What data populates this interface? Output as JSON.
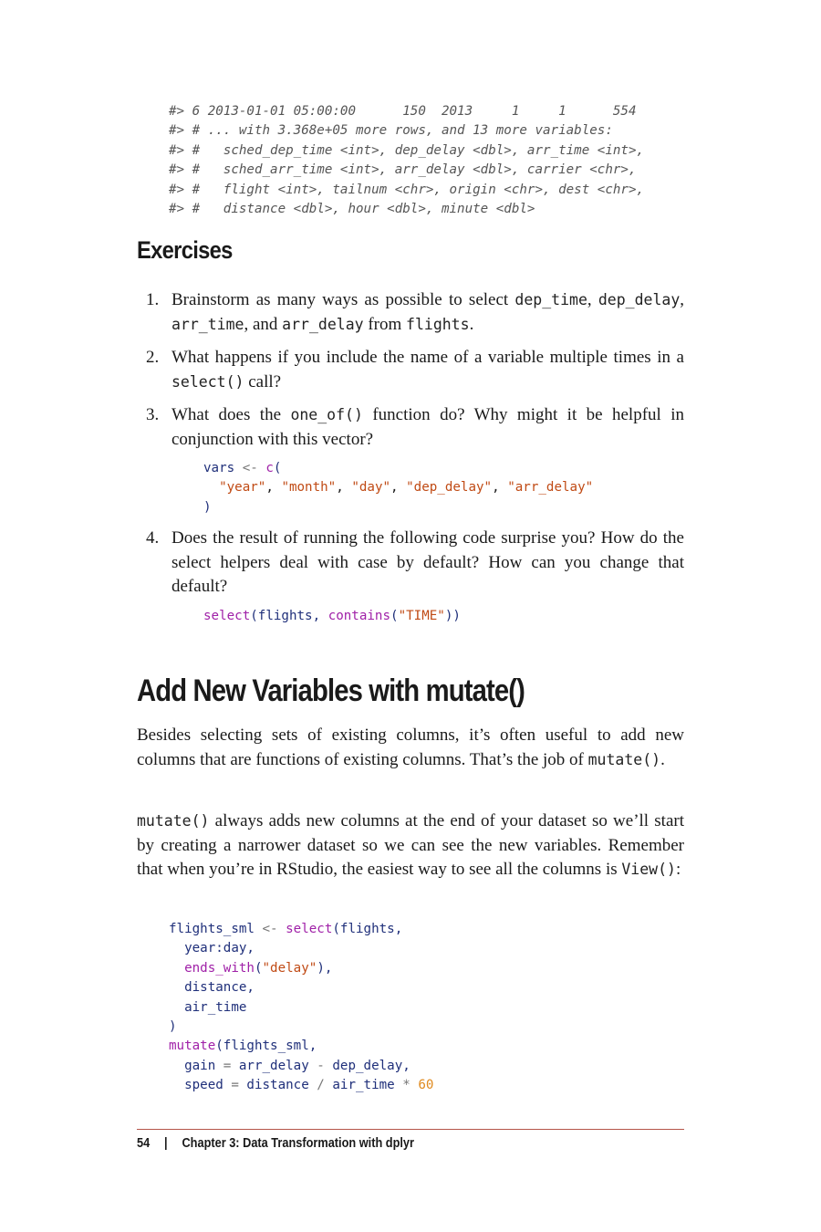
{
  "output_lines": [
    "#> 6 2013-01-01 05:00:00      150  2013     1     1      554",
    "#> # ... with 3.368e+05 more rows, and 13 more variables:",
    "#> #   sched_dep_time <int>, dep_delay <dbl>, arr_time <int>,",
    "#> #   sched_arr_time <int>, arr_delay <dbl>, carrier <chr>,",
    "#> #   flight <int>, tailnum <chr>, origin <chr>, dest <chr>,",
    "#> #   distance <dbl>, hour <dbl>, minute <dbl>"
  ],
  "exercises": {
    "heading": "Exercises",
    "items": [
      {
        "num": "1.",
        "parts": [
          "Brainstorm as many ways as possible to select ",
          "dep_time",
          ", ",
          "dep_delay",
          ", ",
          "arr_time",
          ", and ",
          "arr_delay",
          " from ",
          "flights",
          "."
        ]
      },
      {
        "num": "2.",
        "parts": [
          "What happens if you include the name of a variable multiple times in a ",
          "select()",
          " call?"
        ]
      },
      {
        "num": "3.",
        "parts": [
          "What does the ",
          "one_of()",
          " function do? Why might it be helpful in conjunction with this vector?"
        ],
        "code": {
          "l1_var": "vars",
          "l1_op": " <- ",
          "l1_fn": "c",
          "l1_p": "(",
          "l2_indent": "  ",
          "l2_s1": "\"year\"",
          "l2_s2": "\"month\"",
          "l2_s3": "\"day\"",
          "l2_s4": "\"dep_delay\"",
          "l2_s5": "\"arr_delay\"",
          "comma": ", ",
          "l3": ")"
        }
      },
      {
        "num": "4.",
        "parts": [
          "Does the result of running the following code surprise you? How do the select helpers deal with case by default? How can you change that default?"
        ],
        "code": {
          "fn1": "select",
          "p1": "(",
          "arg": "flights",
          "comma": ", ",
          "fn2": "contains",
          "p2": "(",
          "str": "\"TIME\"",
          "p3": "))"
        }
      }
    ]
  },
  "section": {
    "heading": "Add New Variables with mutate()",
    "para1": [
      "Besides selecting sets of existing columns, it’s often useful to add new columns that are functions of existing columns. That’s the job of ",
      "mutate()",
      "."
    ],
    "para2": [
      "mutate()",
      " always adds new columns at the end of your dataset so we’ll start by creating a narrower dataset so we can see the new vari­ables. Remember that when you’re in RStudio, the easiest way to see all the columns is ",
      "View()",
      ":"
    ]
  },
  "code_block": {
    "l1_a": "flights_sml",
    "l1_op": " <- ",
    "l1_fn": "select",
    "l1_b": "(flights,",
    "l2": "  year:day,",
    "l3_fn": "ends_with",
    "l3_p": "(",
    "l3_s": "\"delay\"",
    "l3_e": "),",
    "l4": "  distance,",
    "l5": "  air_time",
    "l6": ")",
    "l7_fn": "mutate",
    "l7_b": "(flights_sml,",
    "l8_a": "  gain",
    "l8_op1": " = ",
    "l8_b": "arr_delay",
    "l8_op2": " - ",
    "l8_c": "dep_delay,",
    "l9_a": "  speed",
    "l9_op1": " = ",
    "l9_b": "distance",
    "l9_op2": " / ",
    "l9_c": "air_time",
    "l9_op3": " * ",
    "l9_n": "60"
  },
  "footer": {
    "page": "54",
    "separator": "|",
    "chapter": "Chapter 3: Data Transformation with dplyr"
  }
}
